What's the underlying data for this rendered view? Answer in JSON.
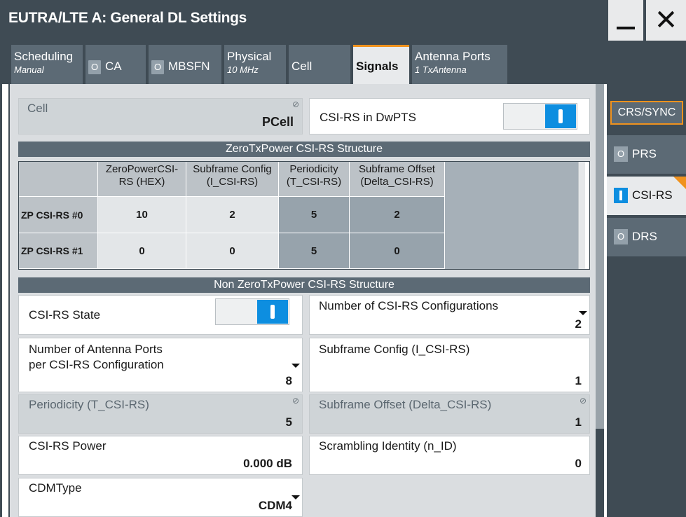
{
  "window": {
    "title": "EUTRA/LTE A: General DL Settings",
    "minimize_label": "",
    "close_label": "✕"
  },
  "tabs": [
    {
      "label": "Scheduling",
      "sub": "Manual"
    },
    {
      "label": "CA",
      "indicator": "O"
    },
    {
      "label": "MBSFN",
      "indicator": "O"
    },
    {
      "label": "Physical",
      "sub": "10 MHz"
    },
    {
      "label": "Cell"
    },
    {
      "label": "Signals",
      "active": true
    },
    {
      "label": "Antenna Ports",
      "sub": "1 TxAntenna"
    }
  ],
  "cell": {
    "label": "Cell",
    "value": "PCell"
  },
  "csi_rs_dwpts": {
    "label": "CSI-RS in DwPTS",
    "state": "on"
  },
  "zero_power": {
    "header": "ZeroTxPower CSI-RS Structure",
    "columns": [
      "ZeroPowerCSI-RS (HEX)",
      "Subframe Config (I_CSI-RS)",
      "Periodicity (T_CSI-RS)",
      "Subframe Offset (Delta_CSI-RS)"
    ],
    "col_lines": [
      [
        "ZeroPowerCSI-",
        "RS (HEX)"
      ],
      [
        "Subframe Config",
        "(I_CSI-RS)"
      ],
      [
        "Periodicity",
        "(T_CSI-RS)"
      ],
      [
        "Subframe Offset",
        "(Delta_CSI-RS)"
      ]
    ],
    "rows": [
      {
        "label": "ZP CSI-RS #0",
        "values": [
          "10",
          "2",
          "5",
          "2"
        ]
      },
      {
        "label": "ZP CSI-RS #1",
        "values": [
          "0",
          "0",
          "5",
          "0"
        ]
      }
    ]
  },
  "non_zero_power": {
    "header": "Non ZeroTxPower CSI-RS Structure",
    "csi_rs_state": {
      "label": "CSI-RS State",
      "state": "on"
    },
    "num_configs": {
      "label": "Number of CSI-RS Configurations",
      "value": "2"
    },
    "antenna_ports": {
      "label_line1": "Number of Antenna Ports",
      "label_line2": "per CSI-RS Configuration",
      "value": "8"
    },
    "subframe_config": {
      "label": "Subframe Config (I_CSI-RS)",
      "value": "1"
    },
    "periodicity": {
      "label": "Periodicity (T_CSI-RS)",
      "value": "5"
    },
    "subframe_offset": {
      "label": "Subframe Offset (Delta_CSI-RS)",
      "value": "1"
    },
    "power": {
      "label": "CSI-RS Power",
      "value": "0.000 dB"
    },
    "scrambling": {
      "label": "Scrambling Identity (n_ID)",
      "value": "0"
    },
    "cdm_type": {
      "label": "CDMType",
      "value": "CDM4"
    }
  },
  "sidenav": {
    "crs_sync": "CRS/SYNC",
    "prs": {
      "label": "PRS",
      "indicator": "O"
    },
    "csi_rs": {
      "label": "CSI-RS"
    },
    "drs": {
      "label": "DRS",
      "indicator": "O"
    }
  },
  "lock_glyph": "⊘",
  "colors": {
    "accent": "#f0921e",
    "toggle_on": "#0d8ee0",
    "chrome": "#3f4b54"
  }
}
